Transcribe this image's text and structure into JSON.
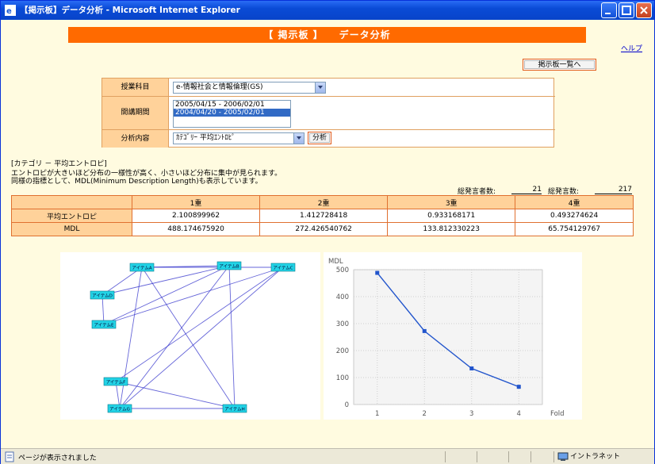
{
  "window": {
    "title": "【掲示板】データ分析 - Microsoft Internet Explorer"
  },
  "page": {
    "banner": "【 掲示板 】　　データ分析",
    "help_link": "ヘルプ",
    "back_button": "掲示板一覧へ"
  },
  "form": {
    "course_label": "授業科目",
    "course_value": "e-情報社会と情報倫理(GS)",
    "period_label": "開講期間",
    "period_options": [
      "2005/04/15 - 2006/02/01",
      "2004/04/20 - 2005/02/01"
    ],
    "period_selected_index": 1,
    "analysis_label": "分析内容",
    "analysis_value": "ｶﾃｺﾞﾘｰ 平均ｴﾝﾄﾛﾋﾟ",
    "analyze_button": "分析"
  },
  "description": {
    "heading": "[カテゴリ － 平均エントロピ]",
    "line1": "エントロピが大きいほど分布の一様性が高く、小さいほど分布に集中が見られます。",
    "line2": "同様の指標として、MDL(Minimum Description Length)も表示しています。"
  },
  "stats": {
    "posters_label": "総発言者数:",
    "posters_value": "21",
    "posts_label": "総発言数:",
    "posts_value": "217"
  },
  "table": {
    "headers": [
      "",
      "1重",
      "2重",
      "3重",
      "4重"
    ],
    "rows": [
      {
        "label": "平均エントロピ",
        "values": [
          "2.100899962",
          "1.412728418",
          "0.933168171",
          "0.493274624"
        ]
      },
      {
        "label": "MDL",
        "values": [
          "488.174675920",
          "272.426540762",
          "133.812330223",
          "65.754129767"
        ]
      }
    ]
  },
  "graph": {
    "nodes": [
      "アイテムA",
      "アイテムB",
      "アイテムC",
      "アイテムD",
      "アイテムE",
      "アイテムF",
      "アイテムG",
      "アイテムH",
      "アイテムI"
    ],
    "node_color": "#22d3e6",
    "edge_color": "#3333cc"
  },
  "chart_data": {
    "type": "line",
    "title": "",
    "xlabel": "Fold",
    "ylabel": "MDL",
    "x": [
      1,
      2,
      3,
      4
    ],
    "values": [
      488.17467592,
      272.426540762,
      133.812330223,
      65.754129767
    ],
    "xlim": [
      0.5,
      4.5
    ],
    "ylim": [
      0,
      500
    ],
    "yticks": [
      0,
      100,
      200,
      300,
      400,
      500
    ],
    "xticks": [
      1,
      2,
      3,
      4
    ],
    "line_color": "#2255cc",
    "grid": true
  },
  "status": {
    "text": "ページが表示されました",
    "zone": "イントラネット"
  }
}
